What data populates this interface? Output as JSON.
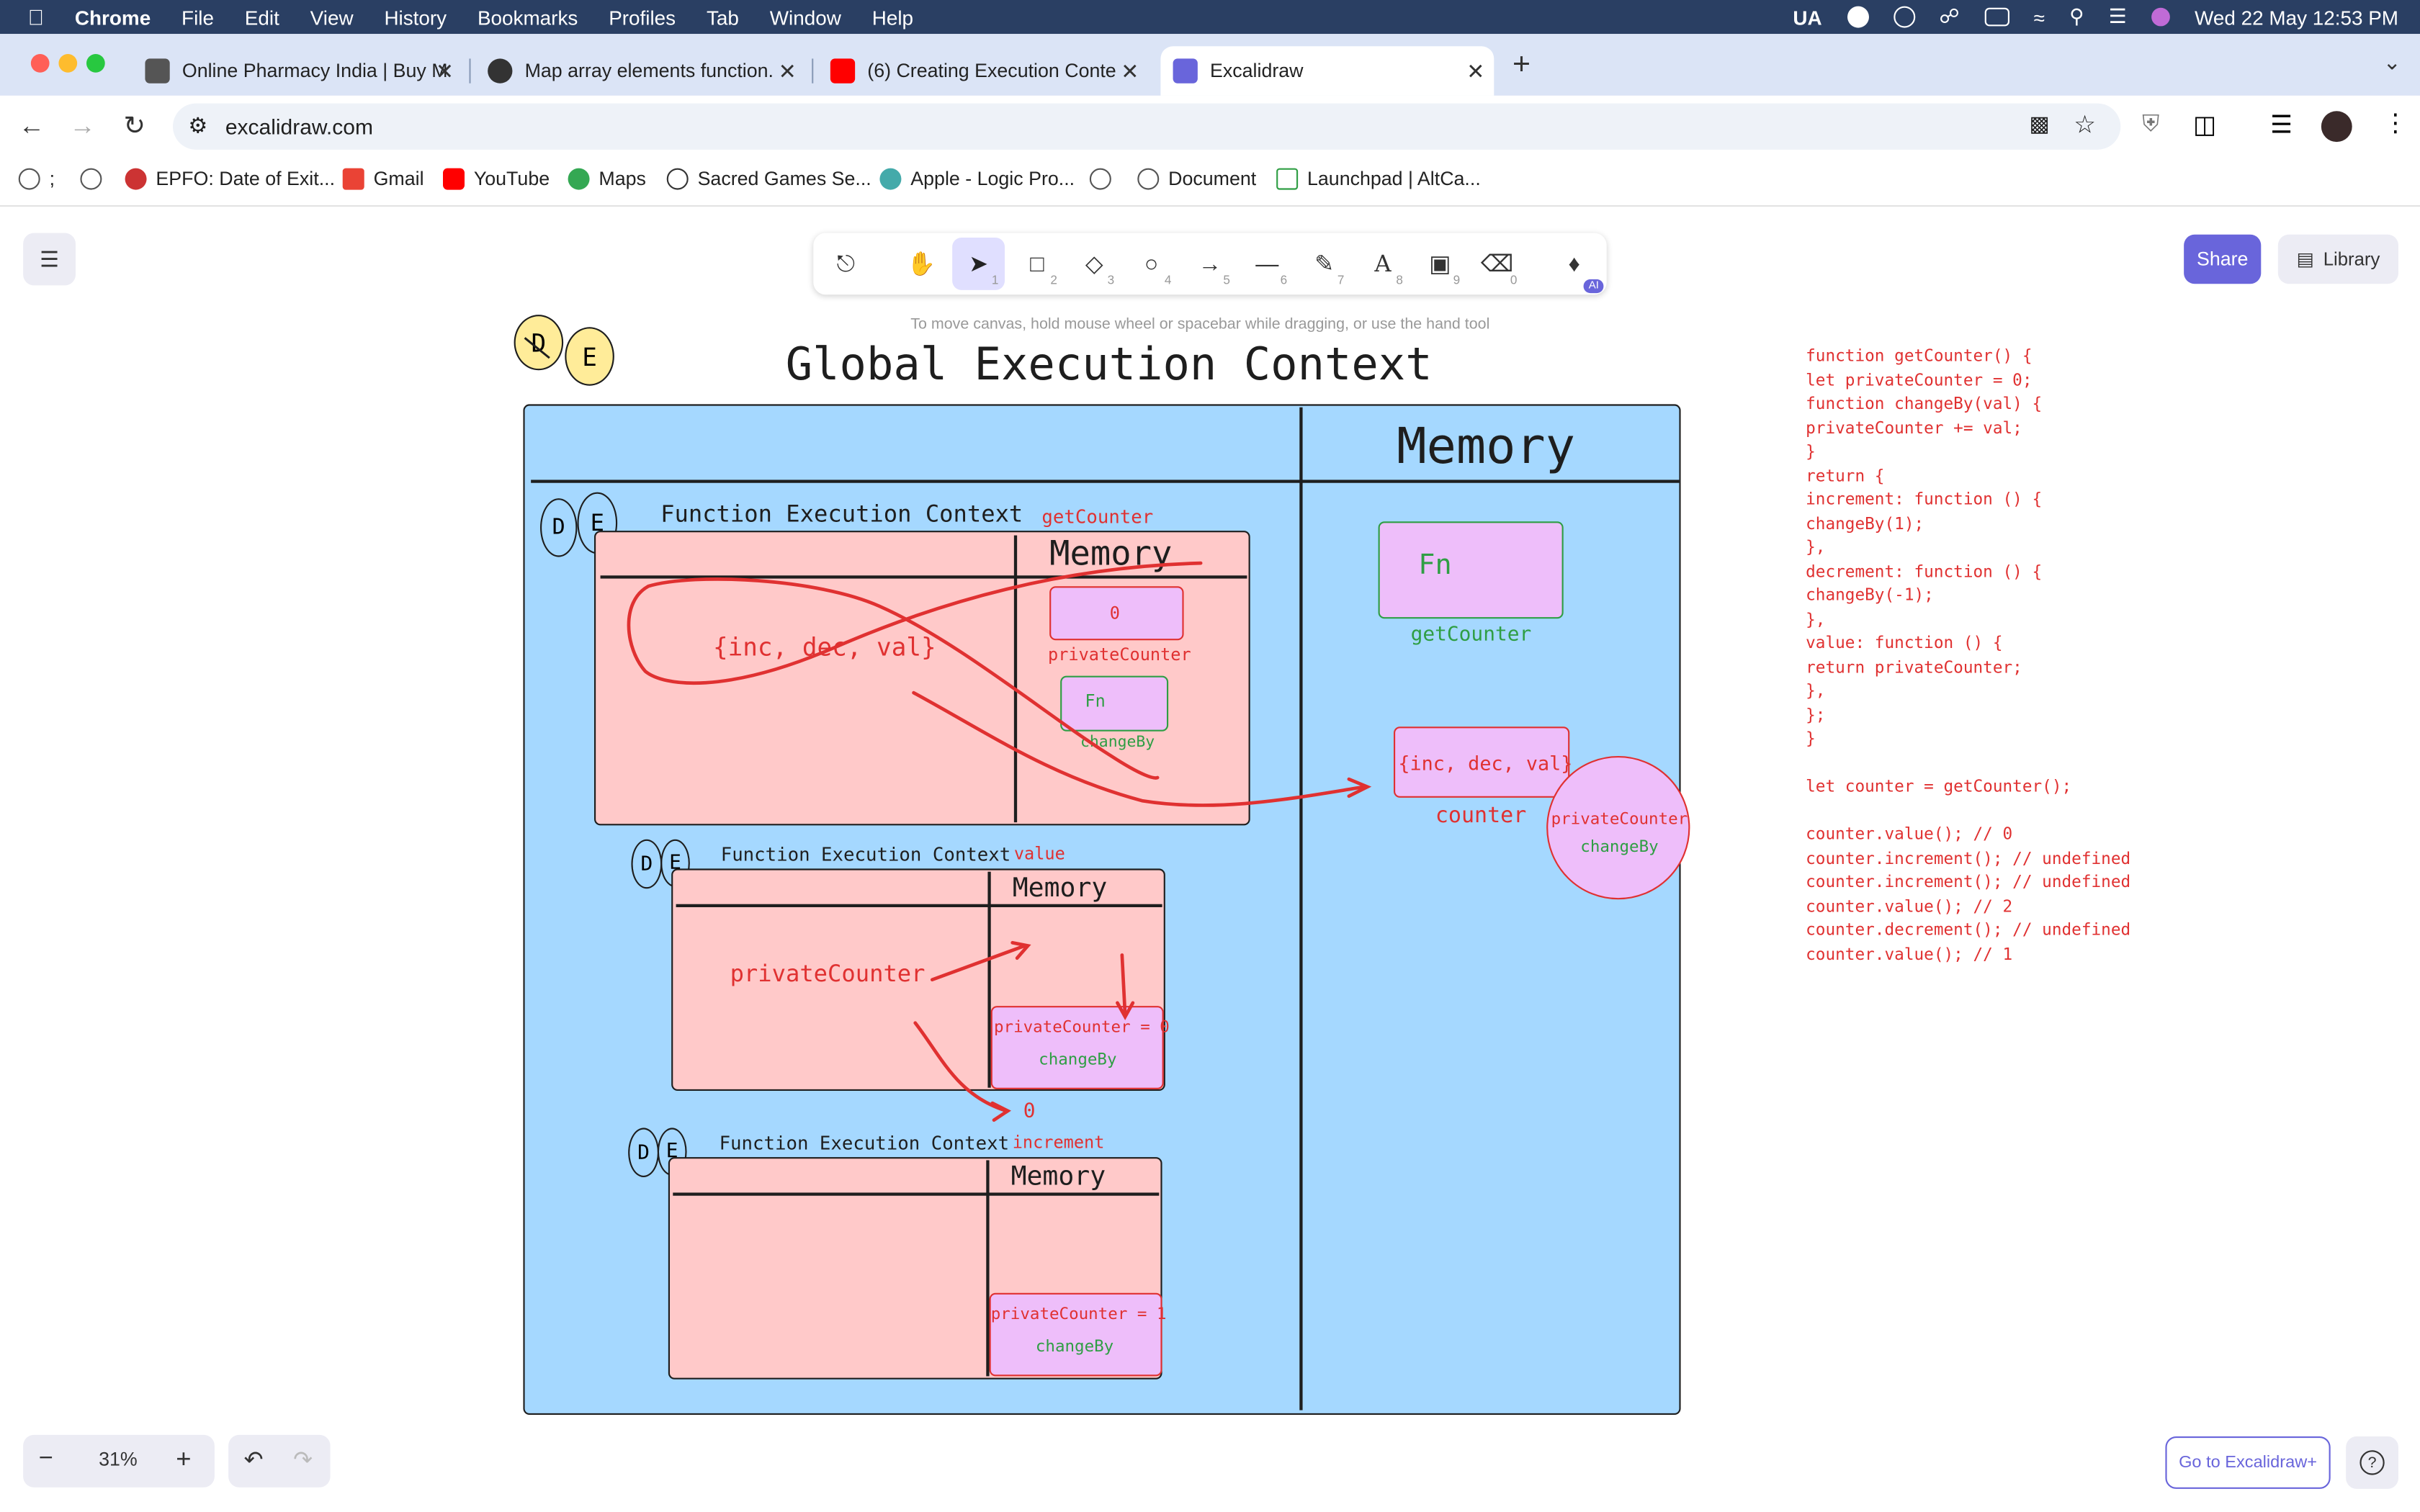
{
  "menubar": {
    "app": "Chrome",
    "items": [
      "File",
      "Edit",
      "View",
      "History",
      "Bookmarks",
      "Profiles",
      "Tab",
      "Window",
      "Help"
    ],
    "status_lang": "UA",
    "datetime": "Wed 22 May  12:53 PM"
  },
  "tabs": [
    {
      "title": "Online Pharmacy India | Buy M",
      "favicon_color": "#555555"
    },
    {
      "title": "Map array elements function.",
      "favicon_color": "#333333"
    },
    {
      "title": "(6) Creating Execution Conte",
      "favicon_color": "#ff0000"
    },
    {
      "title": "Excalidraw",
      "favicon_color": "#6965db"
    }
  ],
  "address": {
    "url": "excalidraw.com"
  },
  "bookmarks": [
    {
      "label": ";"
    },
    {
      "label": ""
    },
    {
      "label": "EPFO: Date of Exit..."
    },
    {
      "label": "Gmail"
    },
    {
      "label": "YouTube"
    },
    {
      "label": "Maps"
    },
    {
      "label": "Sacred Games Se..."
    },
    {
      "label": "Apple - Logic Pro..."
    },
    {
      "label": ""
    },
    {
      "label": "Document"
    },
    {
      "label": "Launchpad | AltCa..."
    }
  ],
  "toolbar": {
    "hint": "To move canvas, hold mouse wheel or spacebar while dragging, or use the hand tool",
    "tools": [
      {
        "name": "lock",
        "num": ""
      },
      {
        "name": "hand",
        "num": ""
      },
      {
        "name": "selection",
        "num": "1"
      },
      {
        "name": "rectangle",
        "num": "2"
      },
      {
        "name": "diamond",
        "num": "3"
      },
      {
        "name": "ellipse",
        "num": "4"
      },
      {
        "name": "arrow",
        "num": "5"
      },
      {
        "name": "line",
        "num": "6"
      },
      {
        "name": "draw",
        "num": "7"
      },
      {
        "name": "text",
        "num": "8"
      },
      {
        "name": "image",
        "num": "9"
      },
      {
        "name": "eraser",
        "num": "0"
      },
      {
        "name": "ai-tools",
        "num": "AI"
      }
    ],
    "share_label": "Share",
    "library_label": "Library"
  },
  "footer": {
    "zoom": "31%",
    "plus_label": "Go to Excalidraw+",
    "help": "?"
  },
  "drawing": {
    "gec_title": "Global Execution Context",
    "memory_title": "Memory",
    "global_fn": "Fn",
    "global_fn_label": "getCounter",
    "counter_obj": "{inc, dec, val}",
    "counter_label": "counter",
    "closure_text": "privateCounter",
    "closure_sub": "changeBy",
    "de_D": "D",
    "de_E": "E",
    "fec1": {
      "title": "Function Execution Context",
      "tag": "getCounter",
      "memory": "Memory",
      "code": "{inc, dec, val}",
      "mem_value": "0",
      "mem_value_label": "privateCounter",
      "mem_fn": "Fn",
      "mem_fn_label": "changeBy"
    },
    "fec2": {
      "title": "Function Execution Context",
      "tag": "value",
      "memory": "Memory",
      "code": "privateCounter",
      "mem_line1": "privateCounter = 0",
      "mem_line2": "changeBy",
      "result": "0"
    },
    "fec3": {
      "title": "Function Execution Context",
      "tag": "increment",
      "memory": "Memory",
      "mem_line1": "privateCounter = 1",
      "mem_line2": "changeBy"
    },
    "code_lines": [
      "function getCounter() {",
      "let privateCounter = 0;",
      "function changeBy(val) {",
      "privateCounter += val;",
      "}",
      "return {",
      "increment: function () {",
      "changeBy(1);",
      "},",
      "decrement: function () {",
      "changeBy(-1);",
      "},",
      "value: function () {",
      "return privateCounter;",
      "},",
      "};",
      "}",
      "",
      "let counter = getCounter();",
      "",
      "counter.value(); // 0",
      "counter.increment(); // undefined",
      "counter.increment(); // undefined",
      "counter.value(); // 2",
      "counter.decrement(); // undefined",
      "counter.value(); // 1"
    ]
  },
  "colors": {
    "accent": "#6965db",
    "canvas_blue": "#a5d8ff",
    "pink": "#ffc9c9",
    "lavender": "#eebefa",
    "red": "#e03131",
    "green": "#2f9e44",
    "yellow": "#ffec99"
  }
}
